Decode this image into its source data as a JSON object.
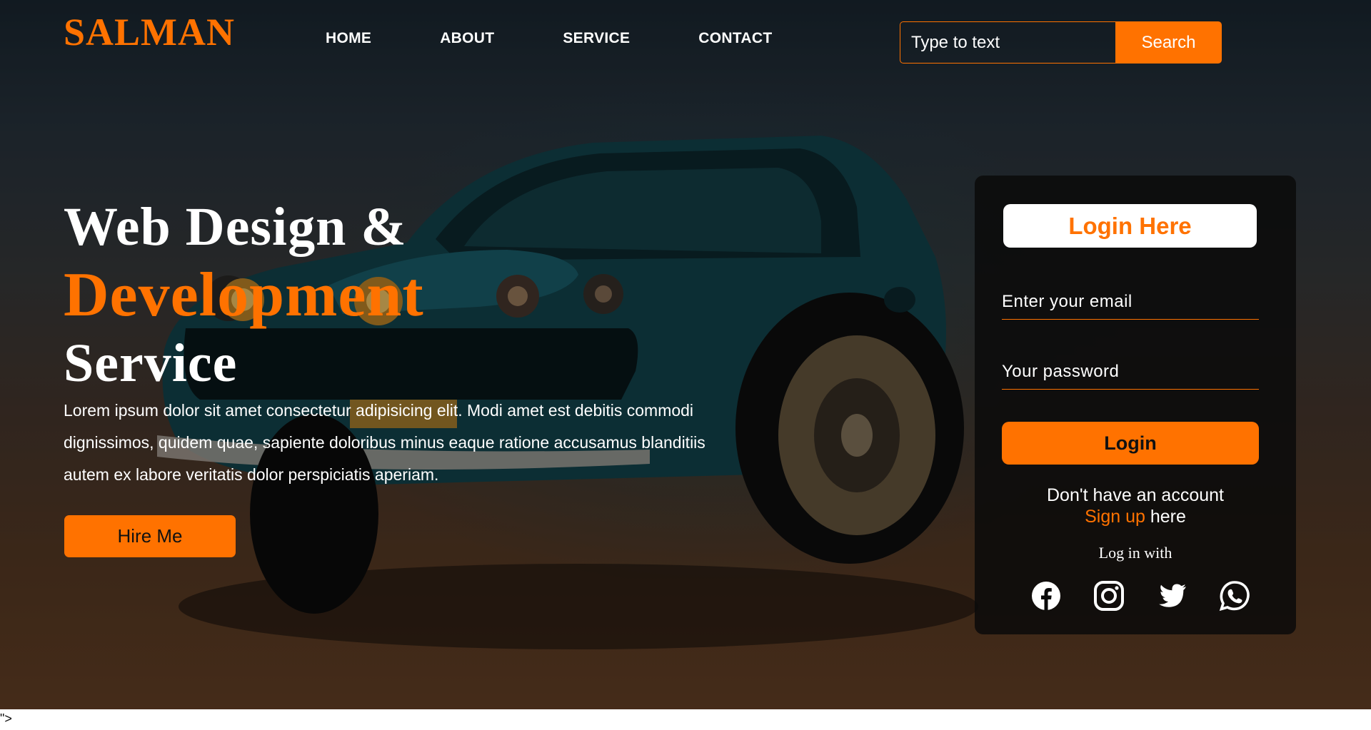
{
  "brand": {
    "logo": "SALMAN",
    "accent_color": "#ff7200"
  },
  "nav": {
    "items": [
      "HOME",
      "ABOUT",
      "SERVICE",
      "CONTACT"
    ]
  },
  "search": {
    "placeholder": "Type to text",
    "button_label": "Search"
  },
  "hero": {
    "headline_line1": "Web Design &",
    "headline_line2": "Development",
    "headline_line3": "Service",
    "paragraph": "Lorem ipsum dolor sit amet consectetur adipisicing elit. Modi amet est debitis commodi dignissimos, quidem quae, sapiente doloribus minus eaque ratione accusamus blanditiis autem ex labore veritatis dolor perspiciatis aperiam.",
    "hire_button": "Hire Me",
    "background_image": "muscle-car"
  },
  "login_card": {
    "title": "Login Here",
    "email_placeholder": "Enter your email",
    "password_placeholder": "Your password",
    "login_button": "Login",
    "no_account_text": "Don't have an account",
    "signup_link": "Sign up",
    "signup_suffix": "here",
    "login_with": "Log in with",
    "social_icons": [
      "facebook-icon",
      "instagram-icon",
      "twitter-icon",
      "whatsapp-icon"
    ]
  },
  "stray_text": "\">"
}
